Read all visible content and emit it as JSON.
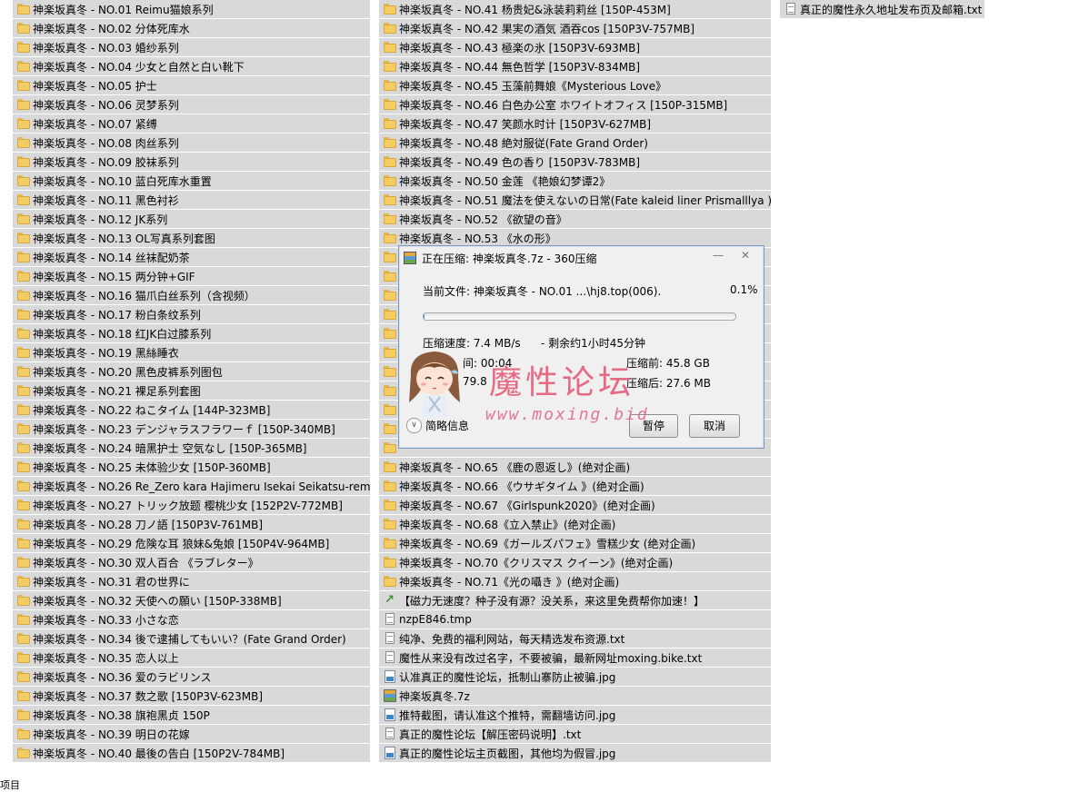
{
  "col1": [
    "神楽坂真冬 - NO.01 Reimu猫娘系列",
    "神楽坂真冬 - NO.02 分体死库水",
    "神楽坂真冬 - NO.03 婚纱系列",
    "神楽坂真冬 - NO.04 少女と自然と白い靴下",
    "神楽坂真冬 - NO.05 护士",
    "神楽坂真冬 - NO.06 灵梦系列",
    "神楽坂真冬 - NO.07 紧缚",
    "神楽坂真冬 - NO.08 肉丝系列",
    "神楽坂真冬 - NO.09 胶袜系列",
    "神楽坂真冬 - NO.10 蓝白死库水重置",
    "神楽坂真冬 - NO.11 黑色衬衫",
    "神楽坂真冬 - NO.12 JK系列",
    "神楽坂真冬 - NO.13 OL写真系列套图",
    "神楽坂真冬 - NO.14 丝袜配奶茶",
    "神楽坂真冬 - NO.15 两分钟+GIF",
    "神楽坂真冬 - NO.16 猫爪白丝系列（含视频）",
    "神楽坂真冬 - NO.17 粉白条纹系列",
    "神楽坂真冬 - NO.18 红JK白过膝系列",
    "神楽坂真冬 - NO.19 黑絲睡衣",
    "神楽坂真冬 - NO.20 黑色皮裤系列图包",
    "神楽坂真冬 - NO.21 裸足系列套图",
    "神楽坂真冬 - NO.22 ねこタイム [144P-323MB]",
    "神楽坂真冬 - NO.23 デンジャラスフラワーｆ [150P-340MB]",
    "神楽坂真冬 - NO.24 暗黑护士 空気なし [150P-365MB]",
    "神楽坂真冬 - NO.25 未体验少女 [150P-360MB]",
    "神楽坂真冬 - NO.26 Re_Zero kara Hajimeru Isekai Seikatsu-rem",
    "神楽坂真冬 - NO.27 トリック放题 樱桃少女 [152P2V-772MB]",
    "神楽坂真冬 - NO.28 刀ノ語 [150P3V-761MB]",
    "神楽坂真冬 - NO.29 危険な耳 狼妹&兔娘 [150P4V-964MB]",
    "神楽坂真冬 - NO.30 双人百合 《ラブレター》",
    "神楽坂真冬 - NO.31 君の世界に",
    "神楽坂真冬 - NO.32 天使への願い [150P-338MB]",
    "神楽坂真冬 - NO.33 小さな恋",
    "神楽坂真冬 - NO.34 後で逮捕してもいい？(Fate Grand Order)",
    "神楽坂真冬 - NO.35 恋人以上",
    "神楽坂真冬 - NO.36 爱のラビリンス",
    "神楽坂真冬 - NO.37 数之歌 [150P3V-623MB]",
    "神楽坂真冬 - NO.38 旗袍黑贞 150P",
    "神楽坂真冬 - NO.39 明日の花嫁",
    "神楽坂真冬 - NO.40 最後の告白 [150P2V-784MB]"
  ],
  "col2": [
    {
      "type": "folder",
      "label": "神楽坂真冬 - NO.41 杨贵妃&泳装莉莉丝 [150P-453M]"
    },
    {
      "type": "folder",
      "label": "神楽坂真冬 - NO.42 果実の酒気 酒吞cos [150P3V-757MB]"
    },
    {
      "type": "folder",
      "label": "神楽坂真冬 - NO.43 極楽の氷 [150P3V-693MB]"
    },
    {
      "type": "folder",
      "label": "神楽坂真冬 - NO.44 無色哲学 [150P3V-834MB]"
    },
    {
      "type": "folder",
      "label": "神楽坂真冬 - NO.45 玉藻前舞娘《Mysterious Love》"
    },
    {
      "type": "folder",
      "label": "神楽坂真冬 - NO.46 白色办公室 ホワイトオフィス [150P-315MB]"
    },
    {
      "type": "folder",
      "label": "神楽坂真冬 - NO.47 笑颜水时计 [150P3V-627MB]"
    },
    {
      "type": "folder",
      "label": "神楽坂真冬 - NO.48 絶対服従(Fate Grand Order)"
    },
    {
      "type": "folder",
      "label": "神楽坂真冬 - NO.49 色の香り [150P3V-783MB]"
    },
    {
      "type": "folder",
      "label": "神楽坂真冬 - NO.50 金莲 《艳娘幻梦谭2》"
    },
    {
      "type": "folder",
      "label": "神楽坂真冬 - NO.51 魔法を使えないの日常(Fate kaleid liner Prismalllya )"
    },
    {
      "type": "folder",
      "label": "神楽坂真冬 - NO.52 《欲望の音》"
    },
    {
      "type": "folder",
      "label": "神楽坂真冬 - NO.53 《水の形》"
    },
    {
      "type": "folder",
      "label": ""
    },
    {
      "type": "folder",
      "label": ""
    },
    {
      "type": "folder",
      "label": ""
    },
    {
      "type": "folder",
      "label": ""
    },
    {
      "type": "folder",
      "label": ""
    },
    {
      "type": "folder",
      "label": ""
    },
    {
      "type": "folder",
      "label": ""
    },
    {
      "type": "folder",
      "label": ""
    },
    {
      "type": "folder",
      "label": ""
    },
    {
      "type": "folder",
      "label": ""
    },
    {
      "type": "folder",
      "label": ""
    },
    {
      "type": "folder",
      "label": "神楽坂真冬 - NO.65 《鹿の恩返し》(绝对企画)"
    },
    {
      "type": "folder",
      "label": "神楽坂真冬 - NO.66 《ウサギタイム 》(绝对企画)"
    },
    {
      "type": "folder",
      "label": "神楽坂真冬 - NO.67 《Girlspunk2020》(绝对企画)"
    },
    {
      "type": "folder",
      "label": "神楽坂真冬 - NO.68《立入禁止》(绝对企画)"
    },
    {
      "type": "folder",
      "label": "神楽坂真冬 - NO.69《ガールズパフェ》雪糕少女 (绝对企画)"
    },
    {
      "type": "folder",
      "label": "神楽坂真冬 - NO.70《クリスマス クイーン》(绝对企画)"
    },
    {
      "type": "folder",
      "label": "神楽坂真冬 - NO.71《光の囁き 》(绝对企画)"
    },
    {
      "type": "lnk",
      "label": "【磁力无速度？种子没有源？没关系，来这里免费帮你加速！】"
    },
    {
      "type": "file",
      "label": "nzpE846.tmp"
    },
    {
      "type": "file",
      "label": "纯净、免费的福利网站，每天精选发布资源.txt"
    },
    {
      "type": "file",
      "label": "魔性从来没有改过名字，不要被骗，最新网址moxing.bike.txt"
    },
    {
      "type": "img",
      "label": "认准真正的魔性论坛，抵制山寨防止被骗.jpg"
    },
    {
      "type": "arc",
      "label": "神楽坂真冬.7z"
    },
    {
      "type": "img",
      "label": "推特截图，请认准这个推特，需翻墙访问.jpg"
    },
    {
      "type": "file",
      "label": "真正的魔性论坛【解压密码说明】.txt"
    },
    {
      "type": "img",
      "label": "真正的魔性论坛主页截图，其他均为假冒.jpg"
    }
  ],
  "col3": [
    {
      "type": "file",
      "label": "真正的魔性永久地址发布页及邮箱.txt"
    }
  ],
  "status_text": "项目",
  "dialog": {
    "title": "正在压缩: 神楽坂真冬.7z - 360压缩",
    "current_file": "当前文件: 神楽坂真冬 - NO.01 ...\\hj8.top(006).",
    "percent_text": "0.1%",
    "percent": 0.001,
    "speed": "压缩速度: 7.4 MB/s",
    "remaining": "- 剩余约1小时45分钟",
    "elapsed_partial": "间: 00:04",
    "before": "压缩前: 45.8 GB",
    "ratio_partial": "79.8",
    "after": "压缩后: 27.6 MB",
    "details_label": "简略信息",
    "pause_label": "暂停",
    "cancel_label": "取消"
  },
  "watermark": {
    "cn": "魔性论坛",
    "url": "www.moxing.bid"
  },
  "colors": {
    "row_bg": "#d9d9d9",
    "folder": "#f3cd63",
    "progress": "#3f87d8",
    "watermark": "#e75f7d"
  }
}
